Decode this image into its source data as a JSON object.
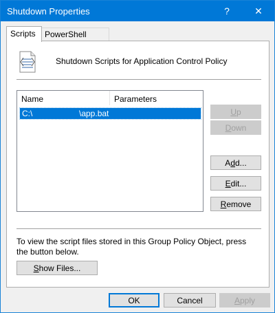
{
  "window": {
    "title": "Shutdown Properties",
    "help_glyph": "?",
    "close_glyph": "✕"
  },
  "tabs": [
    {
      "label": "Scripts",
      "selected": true
    },
    {
      "label": "PowerShell Scripts",
      "selected": false
    }
  ],
  "heading": "Shutdown Scripts for Application Control Policy",
  "table": {
    "columns": [
      "Name",
      "Parameters"
    ],
    "rows": [
      {
        "name": "C:\\",
        "parameters": "\\app.bat",
        "selected": true
      }
    ]
  },
  "side_buttons": {
    "up": {
      "pre": "",
      "accel": "U",
      "post": "p",
      "enabled": false
    },
    "down": {
      "pre": "",
      "accel": "D",
      "post": "own",
      "enabled": false
    },
    "add": {
      "pre": "A",
      "accel": "d",
      "post": "d...",
      "enabled": true
    },
    "edit": {
      "pre": "",
      "accel": "E",
      "post": "dit...",
      "enabled": true
    },
    "remove": {
      "pre": "",
      "accel": "R",
      "post": "emove",
      "enabled": true
    }
  },
  "info_text": "To view the script files stored in this Group Policy Object, press the button below.",
  "show_files": {
    "pre": "",
    "accel": "S",
    "post": "how Files..."
  },
  "footer": {
    "ok": "OK",
    "cancel": "Cancel",
    "apply": {
      "pre": "",
      "accel": "A",
      "post": "pply",
      "enabled": false
    }
  },
  "colors": {
    "titlebar": "#0078d7",
    "selection": "#0078d7",
    "dialog_bg": "#f0f0f0"
  },
  "icons": {
    "script": "script-document-icon"
  }
}
